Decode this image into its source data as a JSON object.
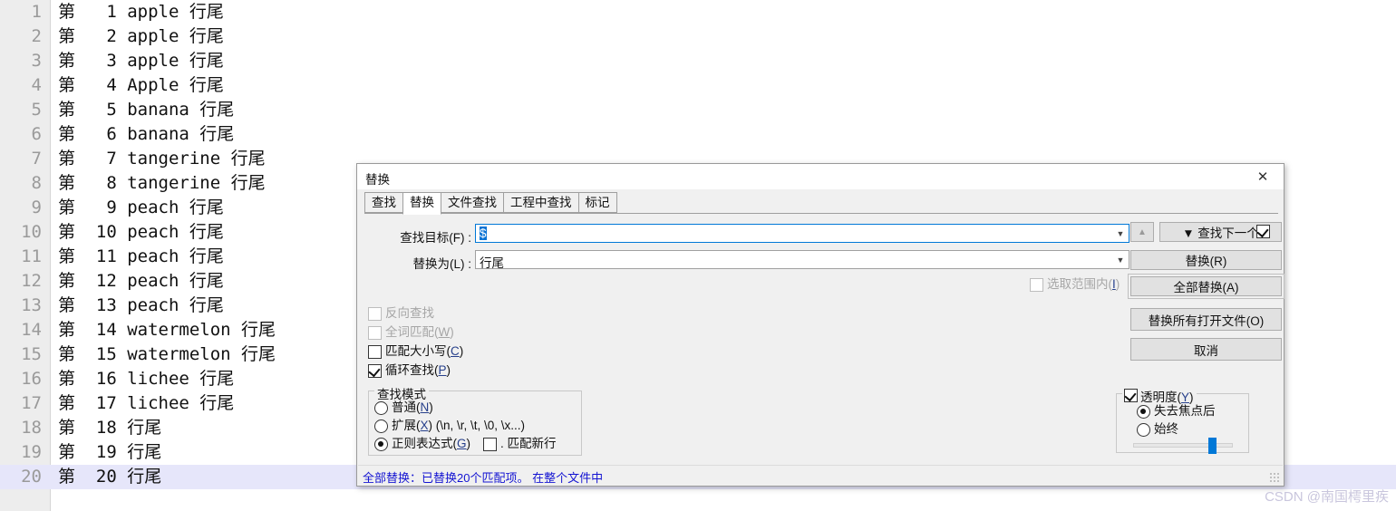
{
  "editor": {
    "lines": [
      {
        "num": "1",
        "text": "第   1 apple 行尾"
      },
      {
        "num": "2",
        "text": "第   2 apple 行尾"
      },
      {
        "num": "3",
        "text": "第   3 apple 行尾"
      },
      {
        "num": "4",
        "text": "第   4 Apple 行尾"
      },
      {
        "num": "5",
        "text": "第   5 banana 行尾"
      },
      {
        "num": "6",
        "text": "第   6 banana 行尾"
      },
      {
        "num": "7",
        "text": "第   7 tangerine 行尾"
      },
      {
        "num": "8",
        "text": "第   8 tangerine 行尾"
      },
      {
        "num": "9",
        "text": "第   9 peach 行尾"
      },
      {
        "num": "10",
        "text": "第  10 peach 行尾"
      },
      {
        "num": "11",
        "text": "第  11 peach 行尾"
      },
      {
        "num": "12",
        "text": "第  12 peach 行尾"
      },
      {
        "num": "13",
        "text": "第  13 peach 行尾"
      },
      {
        "num": "14",
        "text": "第  14 watermelon 行尾"
      },
      {
        "num": "15",
        "text": "第  15 watermelon 行尾"
      },
      {
        "num": "16",
        "text": "第  16 lichee 行尾"
      },
      {
        "num": "17",
        "text": "第  17 lichee 行尾"
      },
      {
        "num": "18",
        "text": "第  18 行尾"
      },
      {
        "num": "19",
        "text": "第  19 行尾"
      },
      {
        "num": "20",
        "text": "第  20 行尾"
      }
    ],
    "current_line_index": 19
  },
  "dialog": {
    "title": "替换",
    "close_icon": "close-icon",
    "tabs": [
      {
        "label": "查找",
        "active": false
      },
      {
        "label": "替换",
        "active": true
      },
      {
        "label": "文件查找",
        "active": false
      },
      {
        "label": "工程中查找",
        "active": false
      },
      {
        "label": "标记",
        "active": false
      }
    ],
    "fields": {
      "find_label": "查找目标(F) :",
      "find_value": "$",
      "find_placeholder": "",
      "replace_label": "替换为(L) :",
      "replace_value": "行尾",
      "replace_placeholder": "",
      "dropdown_icon": "chevron-down-icon"
    },
    "options": [
      {
        "label": "反向查找",
        "accel": "",
        "checked": false,
        "disabled": true
      },
      {
        "label": "全词匹配",
        "accel": "W",
        "checked": false,
        "disabled": true
      },
      {
        "label": "匹配大小写",
        "accel": "C",
        "checked": false,
        "disabled": false
      },
      {
        "label": "循环查找",
        "accel": "P",
        "checked": true,
        "disabled": false
      }
    ],
    "in_selection": {
      "label": "选取范围内",
      "accel": "I",
      "checked": false,
      "disabled": true
    },
    "search_mode": {
      "title": "查找模式",
      "items": [
        {
          "label": "普通",
          "accel": "N",
          "selected": false
        },
        {
          "label": "扩展",
          "accel": "X",
          "suffix": " (\\n, \\r, \\t, \\0, \\x...)",
          "selected": false
        },
        {
          "label": "正则表达式",
          "accel": "G",
          "selected": true
        }
      ],
      "dot_matches_newline": {
        "label": ". 匹配新行",
        "checked": false
      }
    },
    "buttons": {
      "up": "▲",
      "find_next": "▼ 查找下一个",
      "replace": "替换(R)",
      "replace_all": "全部替换(A)",
      "replace_all_open_files": "替换所有打开文件(O)",
      "cancel": "取消"
    },
    "top_right_checkbox": {
      "label": "",
      "checked": true
    },
    "transparency": {
      "title": "透明度",
      "accel": "Y",
      "enabled": true,
      "options": [
        {
          "label": "失去焦点后",
          "selected": true
        },
        {
          "label": "始终",
          "selected": false
        }
      ],
      "slider_percent": 80
    },
    "status": "全部替换：已替换20个匹配项。 在整个文件中",
    "status_color": "#1414d2",
    "resize_grip_icon": "resize-grip-icon"
  },
  "watermark": "CSDN @南国樗里疾",
  "colors": {
    "accent": "#0078d7",
    "selection": "#0a73d4",
    "current_line": "#e6e6fa",
    "status_text": "#1414d2"
  }
}
